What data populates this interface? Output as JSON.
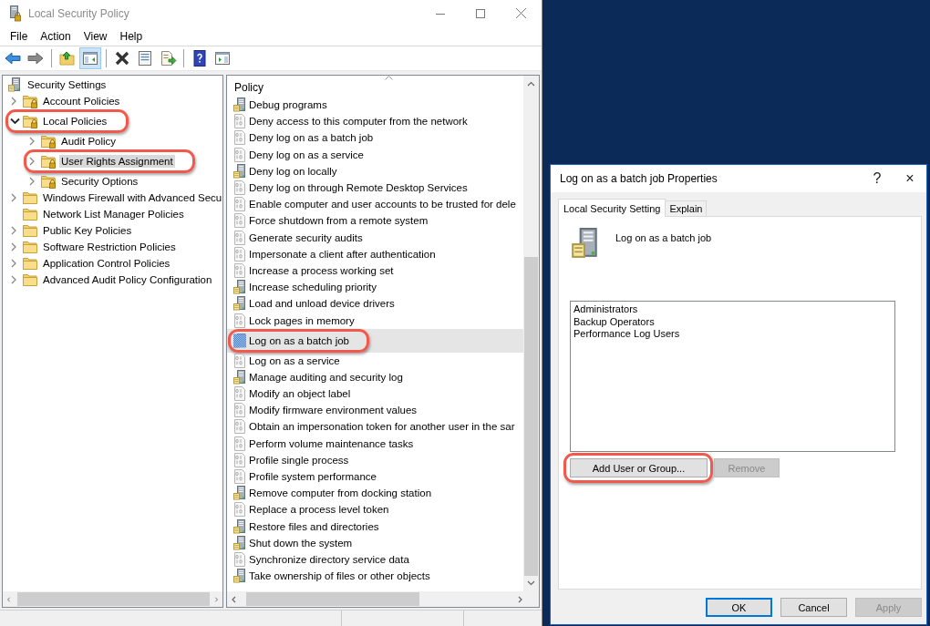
{
  "window": {
    "title": "Local Security Policy"
  },
  "menu": [
    "File",
    "Action",
    "View",
    "Help"
  ],
  "toolbar_groups": [
    {
      "buttons": [
        {
          "kind": "back",
          "disabled": false,
          "pressed": false
        },
        {
          "kind": "forward",
          "disabled": true,
          "pressed": false
        }
      ]
    },
    {
      "buttons": [
        {
          "kind": "up",
          "disabled": false,
          "pressed": false
        },
        {
          "kind": "console-tree",
          "disabled": false,
          "pressed": true
        }
      ]
    },
    {
      "buttons": [
        {
          "kind": "delete",
          "disabled": false,
          "pressed": false
        },
        {
          "kind": "properties",
          "disabled": false,
          "pressed": false
        },
        {
          "kind": "export",
          "disabled": false,
          "pressed": false
        }
      ]
    },
    {
      "buttons": [
        {
          "kind": "help",
          "disabled": false,
          "pressed": false
        },
        {
          "kind": "action-pane",
          "disabled": false,
          "pressed": false
        }
      ]
    }
  ],
  "tree": {
    "root": {
      "label": "Security Settings",
      "children": [
        {
          "label": "Account Policies",
          "kind": "locked-folder",
          "has_children": true,
          "expanded": false,
          "selected": false,
          "highlighted": false
        },
        {
          "label": "Local Policies",
          "kind": "locked-folder",
          "has_children": true,
          "expanded": true,
          "selected": false,
          "highlighted": true,
          "children": [
            {
              "label": "Audit Policy",
              "kind": "locked-folder",
              "has_children": true,
              "expanded": false,
              "selected": false,
              "highlighted": false
            },
            {
              "label": "User Rights Assignment",
              "kind": "locked-folder",
              "has_children": true,
              "expanded": false,
              "selected": true,
              "highlighted": true
            },
            {
              "label": "Security Options",
              "kind": "locked-folder",
              "has_children": true,
              "expanded": false,
              "selected": false,
              "highlighted": false
            }
          ]
        },
        {
          "label": "Windows Firewall with Advanced Secu",
          "kind": "folder",
          "has_children": true,
          "expanded": false,
          "selected": false,
          "highlighted": false
        },
        {
          "label": "Network List Manager Policies",
          "kind": "folder",
          "has_children": false,
          "selected": false,
          "highlighted": false
        },
        {
          "label": "Public Key Policies",
          "kind": "folder",
          "has_children": true,
          "expanded": false,
          "selected": false,
          "highlighted": false
        },
        {
          "label": "Software Restriction Policies",
          "kind": "folder",
          "has_children": true,
          "expanded": false,
          "selected": false,
          "highlighted": false
        },
        {
          "label": "Application Control Policies",
          "kind": "folder",
          "has_children": true,
          "expanded": false,
          "selected": false,
          "highlighted": false
        },
        {
          "label": "Advanced Audit Policy Configuration",
          "kind": "folder",
          "has_children": true,
          "expanded": false,
          "selected": false,
          "highlighted": false
        }
      ]
    }
  },
  "policies": {
    "column": "Policy",
    "rows": [
      {
        "label": "Debug programs",
        "kind": "server",
        "selected": false,
        "highlighted": false
      },
      {
        "label": "Deny access to this computer from the network",
        "kind": "binary",
        "selected": false,
        "highlighted": false
      },
      {
        "label": "Deny log on as a batch job",
        "kind": "binary",
        "selected": false,
        "highlighted": false
      },
      {
        "label": "Deny log on as a service",
        "kind": "binary",
        "selected": false,
        "highlighted": false
      },
      {
        "label": "Deny log on locally",
        "kind": "server",
        "selected": false,
        "highlighted": false
      },
      {
        "label": "Deny log on through Remote Desktop Services",
        "kind": "binary",
        "selected": false,
        "highlighted": false
      },
      {
        "label": "Enable computer and user accounts to be trusted for dele",
        "kind": "binary",
        "selected": false,
        "highlighted": false
      },
      {
        "label": "Force shutdown from a remote system",
        "kind": "binary",
        "selected": false,
        "highlighted": false
      },
      {
        "label": "Generate security audits",
        "kind": "binary",
        "selected": false,
        "highlighted": false
      },
      {
        "label": "Impersonate a client after authentication",
        "kind": "binary",
        "selected": false,
        "highlighted": false
      },
      {
        "label": "Increase a process working set",
        "kind": "binary",
        "selected": false,
        "highlighted": false
      },
      {
        "label": "Increase scheduling priority",
        "kind": "server",
        "selected": false,
        "highlighted": false
      },
      {
        "label": "Load and unload device drivers",
        "kind": "server",
        "selected": false,
        "highlighted": false
      },
      {
        "label": "Lock pages in memory",
        "kind": "binary",
        "selected": false,
        "highlighted": false
      },
      {
        "label": "Log on as a batch job",
        "kind": "server",
        "selected": true,
        "highlighted": true
      },
      {
        "label": "Log on as a service",
        "kind": "binary",
        "selected": false,
        "highlighted": false
      },
      {
        "label": "Manage auditing and security log",
        "kind": "server",
        "selected": false,
        "highlighted": false
      },
      {
        "label": "Modify an object label",
        "kind": "binary",
        "selected": false,
        "highlighted": false
      },
      {
        "label": "Modify firmware environment values",
        "kind": "binary",
        "selected": false,
        "highlighted": false
      },
      {
        "label": "Obtain an impersonation token for another user in the sar",
        "kind": "binary",
        "selected": false,
        "highlighted": false
      },
      {
        "label": "Perform volume maintenance tasks",
        "kind": "binary",
        "selected": false,
        "highlighted": false
      },
      {
        "label": "Profile single process",
        "kind": "binary",
        "selected": false,
        "highlighted": false
      },
      {
        "label": "Profile system performance",
        "kind": "binary",
        "selected": false,
        "highlighted": false
      },
      {
        "label": "Remove computer from docking station",
        "kind": "server",
        "selected": false,
        "highlighted": false
      },
      {
        "label": "Replace a process level token",
        "kind": "binary",
        "selected": false,
        "highlighted": false
      },
      {
        "label": "Restore files and directories",
        "kind": "server",
        "selected": false,
        "highlighted": false
      },
      {
        "label": "Shut down the system",
        "kind": "server",
        "selected": false,
        "highlighted": false
      },
      {
        "label": "Synchronize directory service data",
        "kind": "binary",
        "selected": false,
        "highlighted": false
      },
      {
        "label": "Take ownership of files or other objects",
        "kind": "server",
        "selected": false,
        "highlighted": false
      }
    ]
  },
  "dialog": {
    "title": "Log on as a batch job Properties",
    "title_buttons": [
      "?",
      "×"
    ],
    "tabs": [
      {
        "label": "Local Security Setting",
        "selected": true
      },
      {
        "label": "Explain",
        "selected": false
      }
    ],
    "policy_name": "Log on as a batch job",
    "members": [
      "Administrators",
      "Backup Operators",
      "Performance Log Users"
    ],
    "actions": [
      {
        "label": "Add User or Group...",
        "disabled": false,
        "highlighted": true
      },
      {
        "label": "Remove",
        "disabled": true,
        "highlighted": false
      }
    ],
    "buttons": [
      {
        "label": "OK",
        "default": true,
        "disabled": false
      },
      {
        "label": "Cancel",
        "default": false,
        "disabled": false
      },
      {
        "label": "Apply",
        "default": false,
        "disabled": true
      }
    ]
  }
}
